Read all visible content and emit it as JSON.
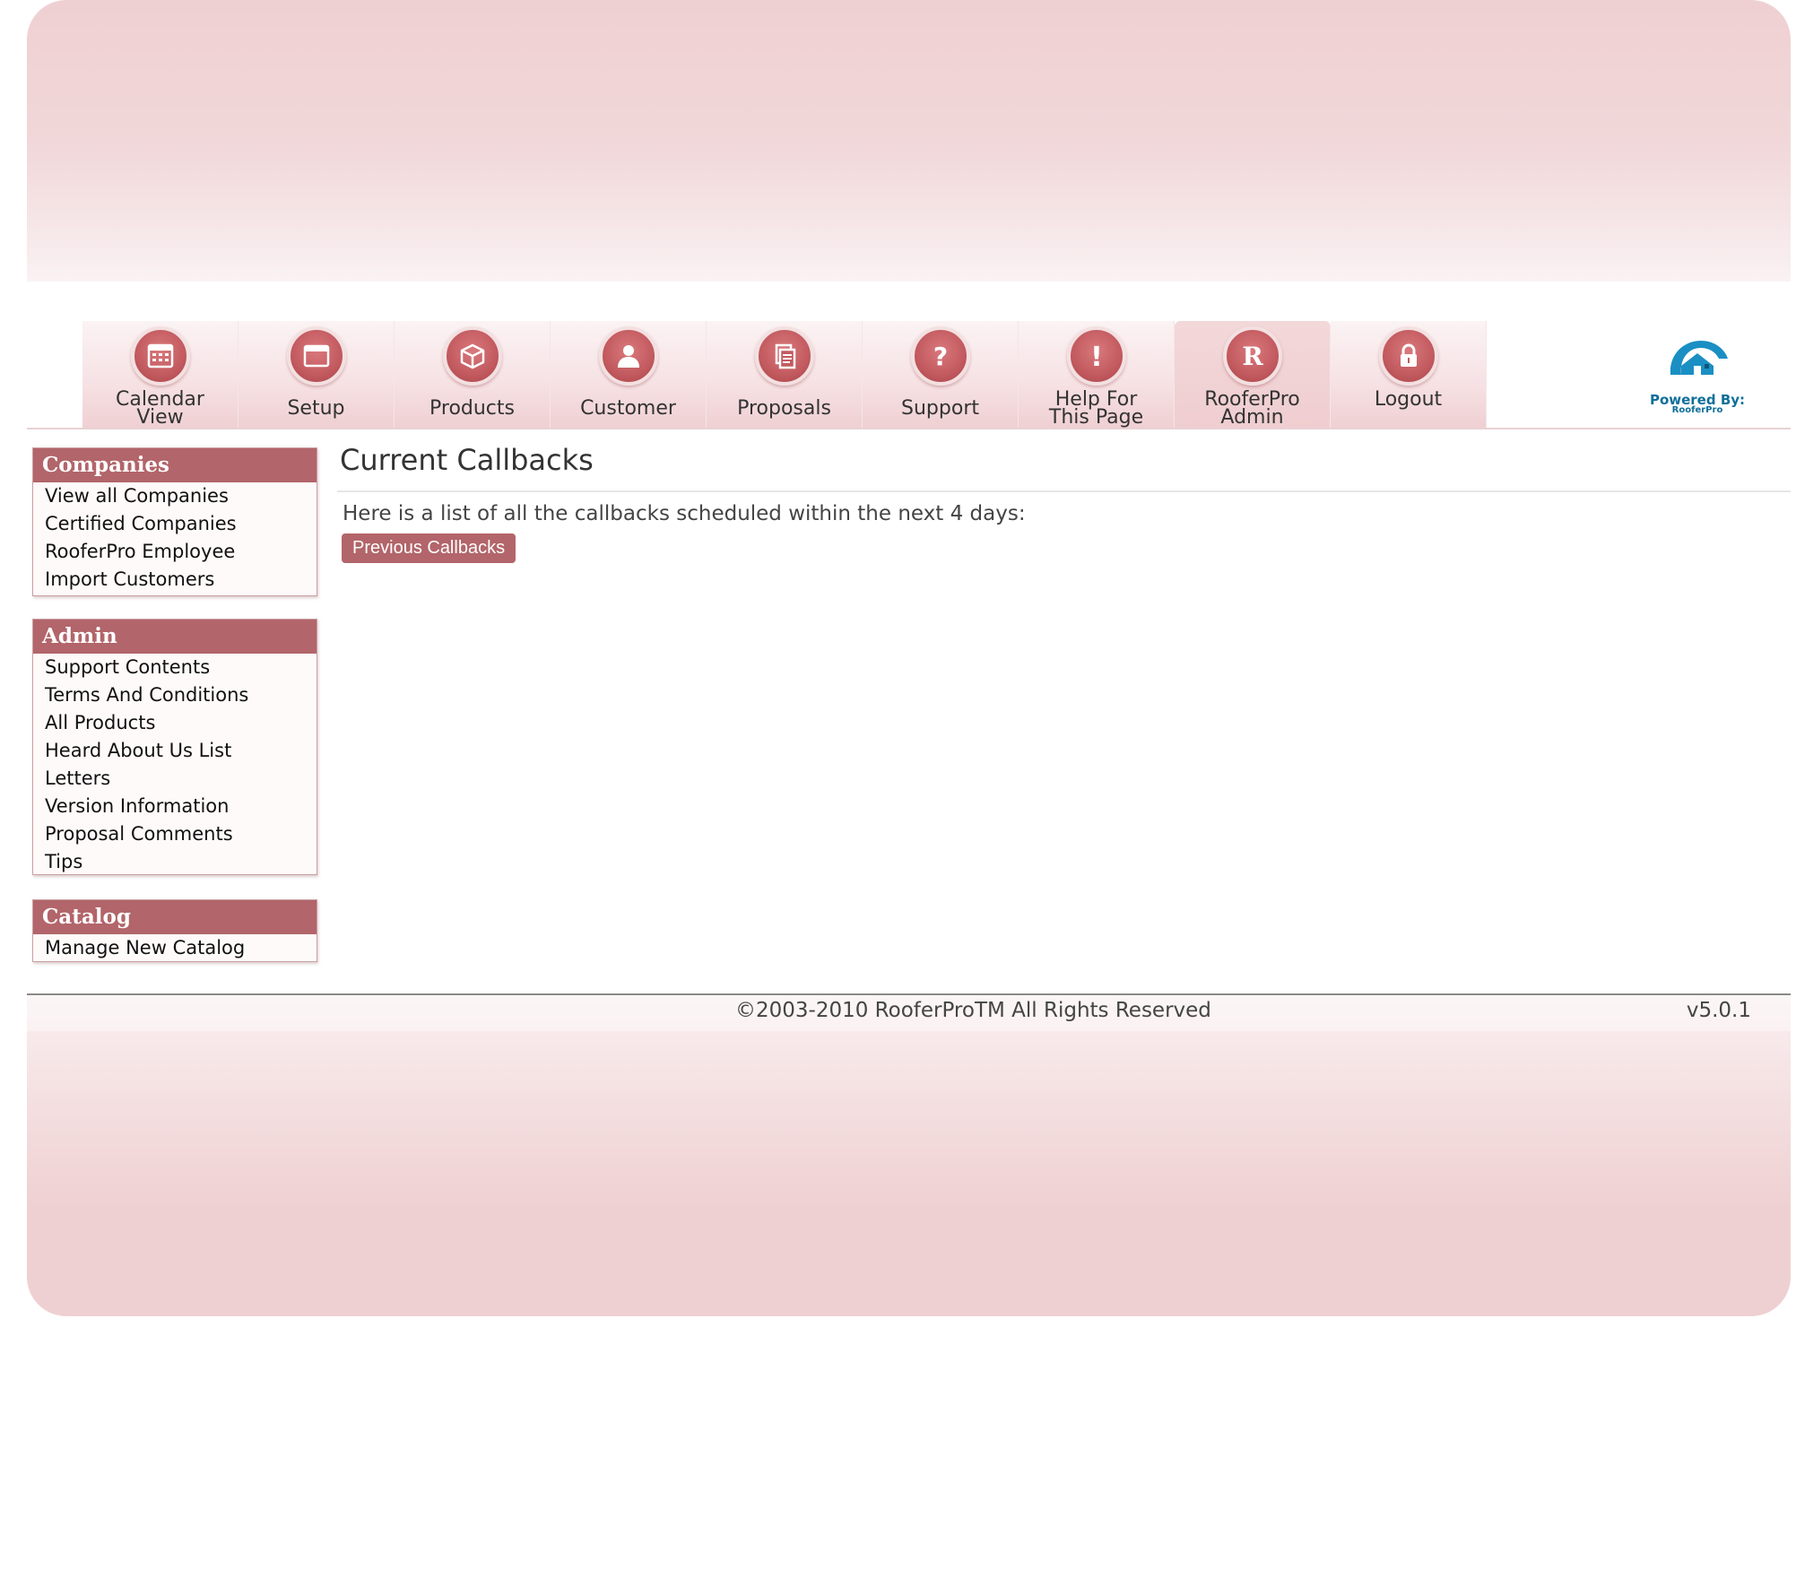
{
  "nav": {
    "items": [
      {
        "label": "Calendar\nView",
        "icon": "calendar-icon"
      },
      {
        "label": "Setup",
        "icon": "window-icon"
      },
      {
        "label": "Products",
        "icon": "box-icon"
      },
      {
        "label": "Customer",
        "icon": "person-icon"
      },
      {
        "label": "Proposals",
        "icon": "documents-icon"
      },
      {
        "label": "Support",
        "icon": "question-icon"
      },
      {
        "label": "Help For\nThis Page",
        "icon": "exclamation-icon"
      },
      {
        "label": "RooferPro\nAdmin",
        "icon": "r-letter-icon",
        "active": true
      },
      {
        "label": "Logout",
        "icon": "lock-icon"
      }
    ]
  },
  "logo": {
    "text": "Powered By:",
    "sub": "RooferPro"
  },
  "sidebar": {
    "companies": {
      "title": "Companies",
      "items": [
        "View all Companies",
        "Certified Companies",
        "RooferPro Employee",
        "Import Customers"
      ]
    },
    "admin": {
      "title": "Admin",
      "items": [
        "Support Contents",
        "Terms And Conditions",
        "All Products",
        "Heard About Us List",
        "Letters",
        "Version Information",
        "Proposal Comments",
        "Tips"
      ]
    },
    "catalog": {
      "title": "Catalog",
      "items": [
        "Manage New Catalog"
      ]
    }
  },
  "main": {
    "title": "Current Callbacks",
    "intro": "Here is a list of all the callbacks scheduled within the next 4 days:",
    "previous_button": "Previous Callbacks"
  },
  "footer": {
    "copyright": "©2003-2010 RooferProTM All Rights Reserved",
    "version": "v5.0.1"
  },
  "colors": {
    "accent": "#b2656a",
    "frame": "#efd0d2"
  }
}
